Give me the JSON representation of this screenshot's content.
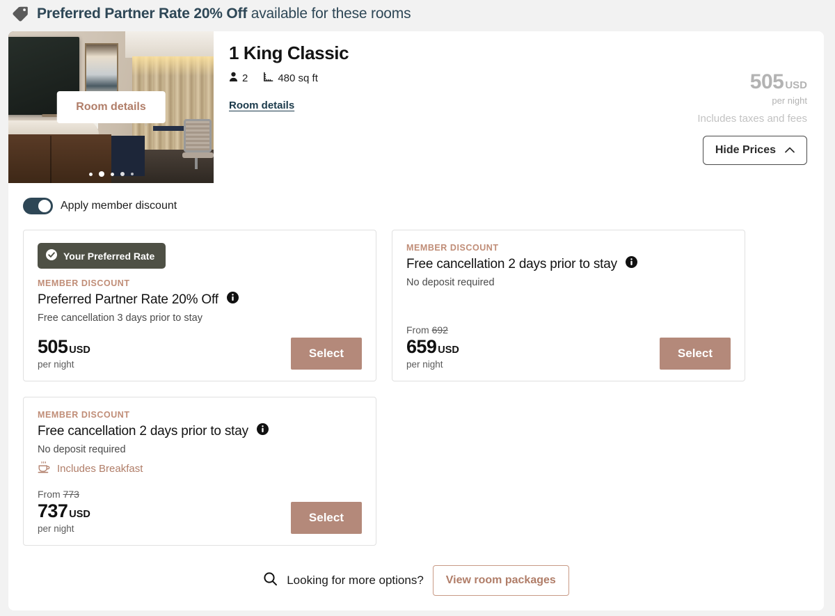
{
  "banner": {
    "icon": "tag-icon",
    "bold_text": "Preferred Partner Rate 20% Off",
    "regular_text": " available for these rooms"
  },
  "gallery": {
    "overlay_button_label": "Room details",
    "dot_count": 5,
    "active_dot_index": 1
  },
  "room": {
    "title": "1 King Classic",
    "occupancy": "2",
    "size": "480 sq ft",
    "details_link": "Room details"
  },
  "price_summary": {
    "amount": "505",
    "currency": "USD",
    "period": "per night",
    "note": "Includes taxes and fees",
    "hide_prices_label": "Hide Prices",
    "chevron": "chevron-up-icon"
  },
  "member_toggle": {
    "label": "Apply member discount",
    "state": "on"
  },
  "rates": [
    {
      "badge": "Your Preferred Rate",
      "member_label": "MEMBER DISCOUNT",
      "title": "Preferred Partner Rate 20% Off",
      "subtitle": "Free cancellation 3 days prior to stay",
      "from_prefix": "",
      "from_price": "",
      "amount": "505",
      "currency": "USD",
      "period": "per night",
      "select_label": "Select",
      "breakfast": ""
    },
    {
      "badge": "",
      "member_label": "MEMBER DISCOUNT",
      "title": "Free cancellation 2 days prior to stay",
      "subtitle": "No deposit required",
      "from_prefix": "From",
      "from_price": "692",
      "amount": "659",
      "currency": "USD",
      "period": "per night",
      "select_label": "Select",
      "breakfast": ""
    },
    {
      "badge": "",
      "member_label": "MEMBER DISCOUNT",
      "title": "Free cancellation 2 days prior to stay",
      "subtitle": "No deposit required",
      "from_prefix": "From",
      "from_price": "773",
      "amount": "737",
      "currency": "USD",
      "period": "per night",
      "select_label": "Select",
      "breakfast": "Includes Breakfast"
    }
  ],
  "footer": {
    "search_icon": "search-icon",
    "prompt": "Looking for more options?",
    "packages_button": "View room packages"
  },
  "colors": {
    "accent_rose": "#b07d68",
    "select_button": "#b4897a",
    "banner_text": "#2e4756",
    "badge_bg": "#4e5045",
    "toggle_on": "#2e4756",
    "page_bg": "#f2f2f2"
  }
}
